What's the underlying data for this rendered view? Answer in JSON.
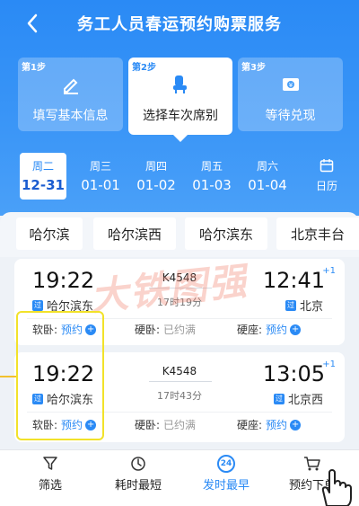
{
  "nav": {
    "title": "务工人员春运预约购票服务",
    "back_icon": "chevron-left-icon"
  },
  "steps": [
    {
      "tag": "第1步",
      "label": "填写基本信息",
      "icon": "pencil-icon"
    },
    {
      "tag": "第2步",
      "label": "选择车次席别",
      "icon": "seat-icon"
    },
    {
      "tag": "第3步",
      "label": "等待兑现",
      "icon": "redeem-icon"
    }
  ],
  "dates": [
    {
      "weekday": "周二",
      "date": "12-31",
      "active": true
    },
    {
      "weekday": "周三",
      "date": "01-01"
    },
    {
      "weekday": "周四",
      "date": "01-02"
    },
    {
      "weekday": "周五",
      "date": "01-03"
    },
    {
      "weekday": "周六",
      "date": "01-04"
    }
  ],
  "calendar": {
    "label": "日历",
    "icon": "calendar-icon"
  },
  "stations": [
    "哈尔滨",
    "哈尔滨西",
    "哈尔滨东",
    "北京丰台"
  ],
  "trains": [
    {
      "dep_time": "19:22",
      "arr_time": "12:41",
      "day_offset": "+1",
      "train_no": "K4548",
      "duration": "17时19分",
      "dep_station": "哈尔滨东",
      "arr_station": "北京",
      "dep_tag": "过",
      "arr_tag": "过",
      "seats": [
        {
          "name": "软卧:",
          "status": "预约"
        },
        {
          "name": "硬卧:",
          "status": "已约满"
        },
        {
          "name": "硬座:",
          "status": "预约"
        }
      ]
    },
    {
      "dep_time": "19:22",
      "arr_time": "13:05",
      "day_offset": "+1",
      "train_no": "K4548",
      "duration": "17时43分",
      "dep_station": "哈尔滨东",
      "arr_station": "北京西",
      "dep_tag": "过",
      "arr_tag": "过",
      "seats": [
        {
          "name": "软卧:",
          "status": "预约"
        },
        {
          "name": "硬卧:",
          "status": "已约满"
        },
        {
          "name": "硬座:",
          "status": "预约"
        }
      ]
    }
  ],
  "bottom_bar": [
    {
      "label": "筛选",
      "icon": "filter-icon"
    },
    {
      "label": "耗时最短",
      "icon": "timer-icon"
    },
    {
      "label": "发时最早",
      "icon": "clock-24-icon",
      "badge": "24",
      "active": true
    },
    {
      "label": "预约下单",
      "icon": "cart-icon"
    }
  ],
  "watermark": "大铁图强",
  "colors": {
    "primary": "#2a8af5",
    "highlight": "#f2e22a"
  }
}
